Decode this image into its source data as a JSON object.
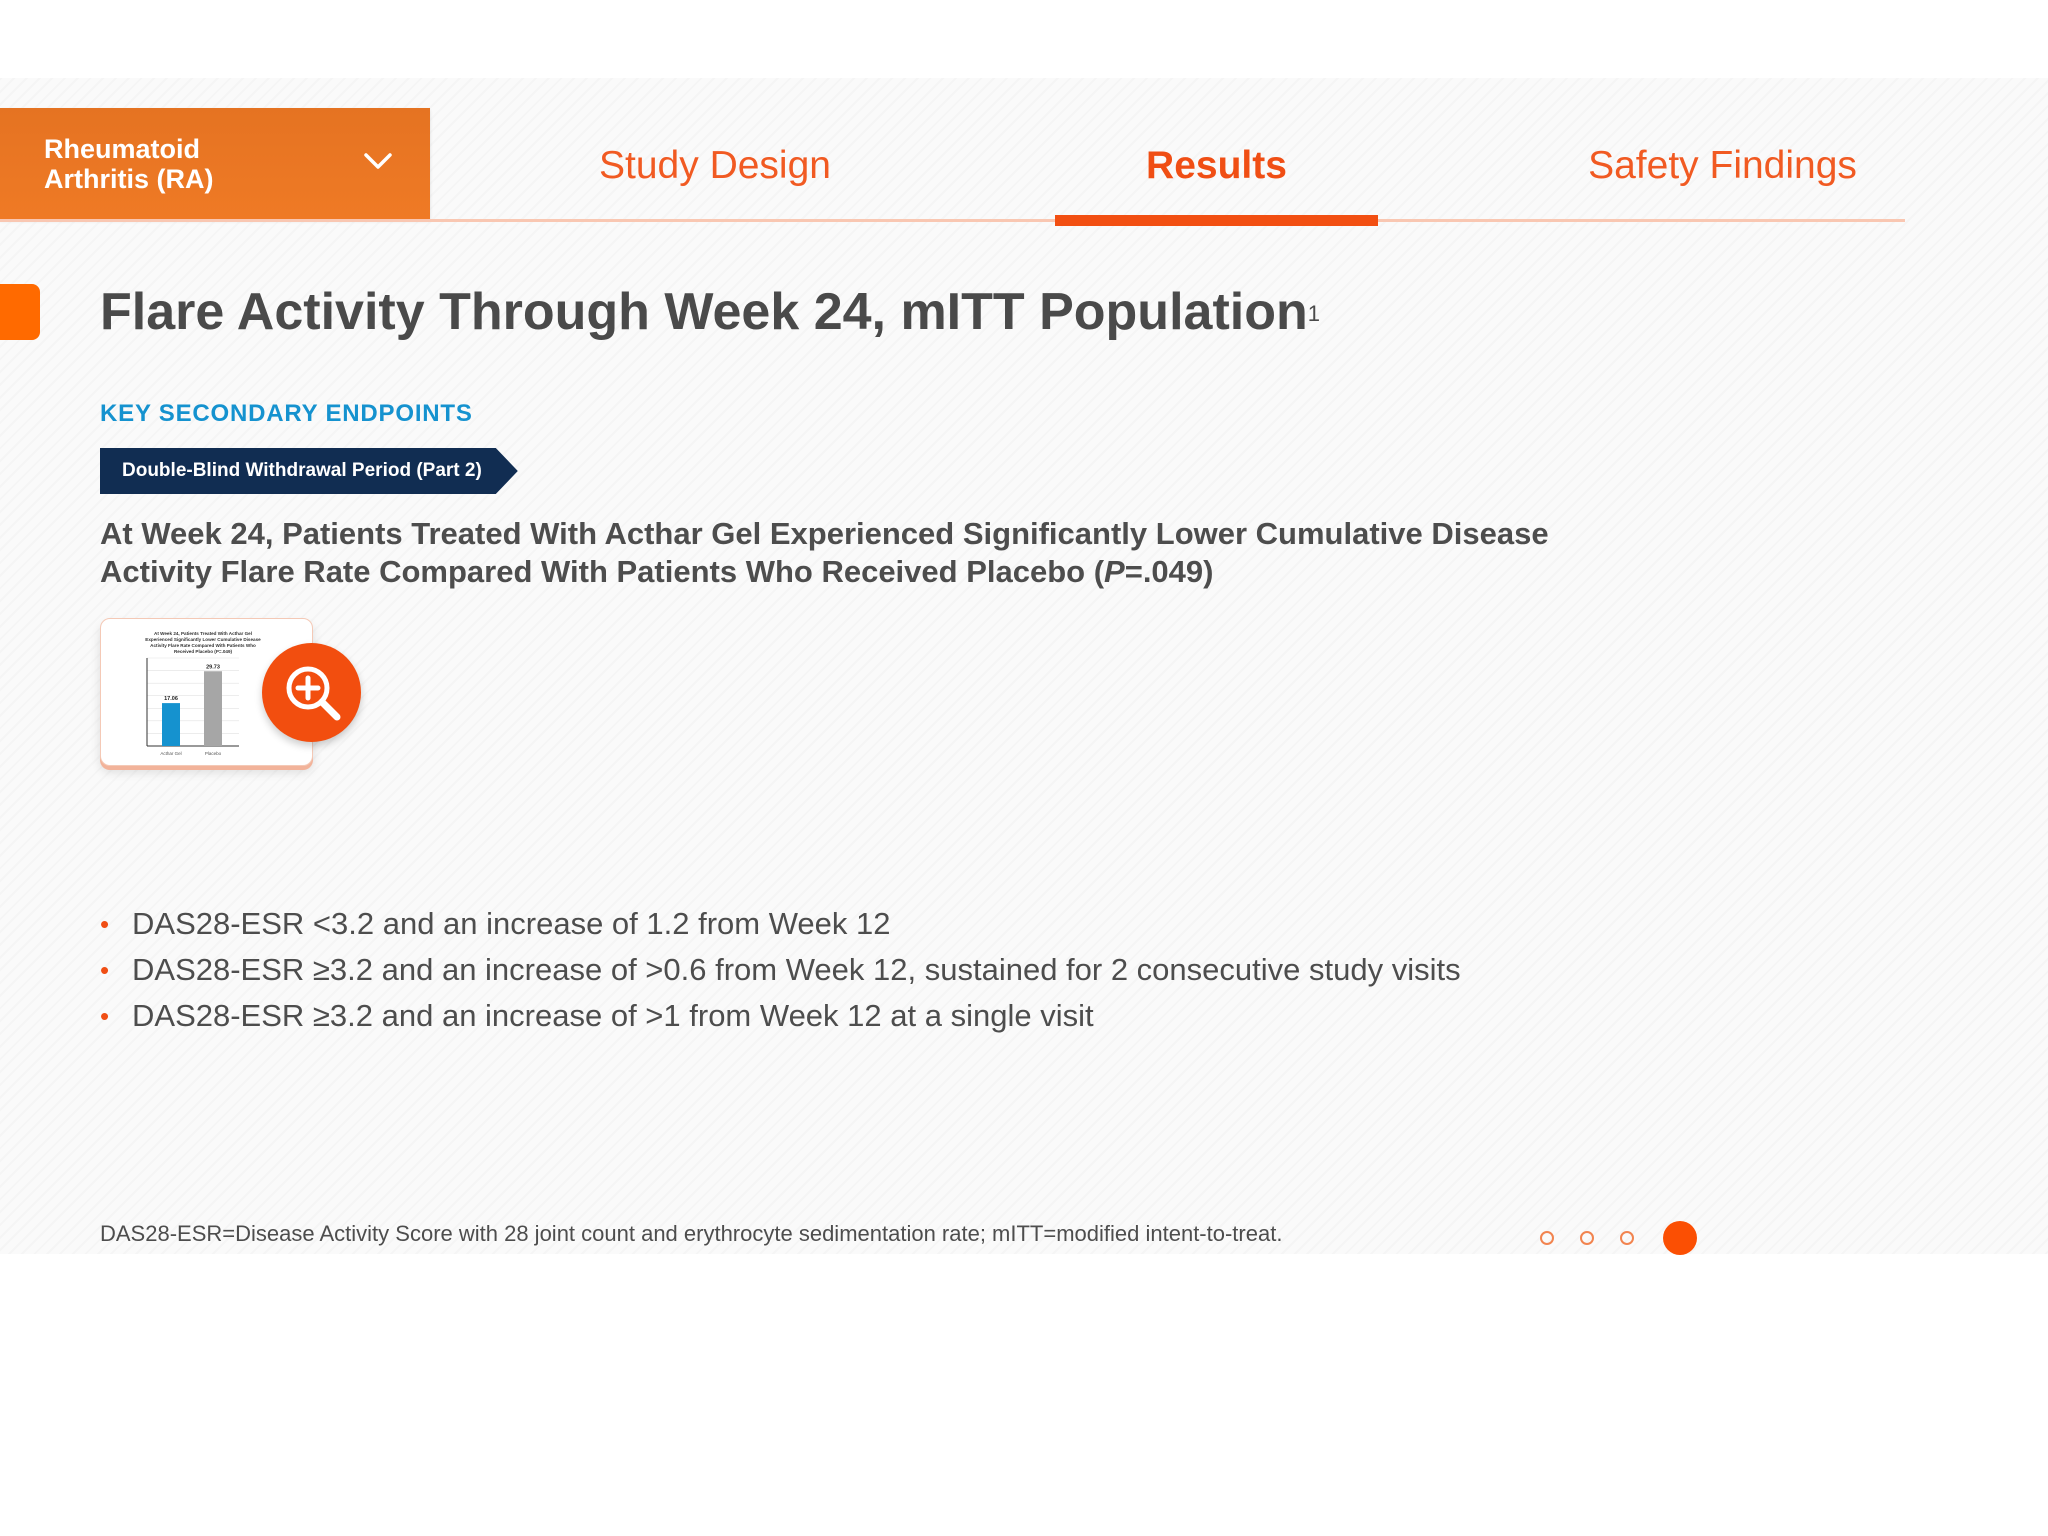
{
  "nav": {
    "dropdown_label": "Rheumatoid Arthritis (RA)",
    "tabs": [
      {
        "label": "Study Design",
        "active": false
      },
      {
        "label": "Results",
        "active": true
      },
      {
        "label": "Safety Findings",
        "active": false
      }
    ]
  },
  "content": {
    "title": "Flare Activity Through Week 24, mITT Population",
    "title_ref": "1",
    "kicker": "KEY SECONDARY ENDPOINTS",
    "ribbon": "Double-Blind Withdrawal Period (Part 2)",
    "headline_part1": "At Week 24, Patients Treated With Acthar Gel Experienced Significantly Lower Cumulative Disease Activity Flare Rate Compared With Patients Who Received Placebo (",
    "headline_p": "P",
    "headline_part2": "=.049)",
    "bullets": [
      "DAS28-ESR <3.2 and an increase of 1.2 from Week 12",
      "DAS28-ESR ≥3.2 and an increase of >0.6 from Week 12, sustained for 2 consecutive study visits",
      "DAS28-ESR ≥3.2 and an increase of >1 from Week 12 at a single visit"
    ],
    "footnote": "DAS28-ESR=Disease Activity Score with 28 joint count and erythrocyte sedimentation rate; mITT=modified intent-to-treat."
  },
  "thumbnail": {
    "title_lines": [
      "At Week 24, Patients Treated With Acthar Gel",
      "Experienced Significantly Lower Cumulative Disease",
      "Activity Flare Rate Compared With Patients Who",
      "Received Placebo (P=.049)"
    ],
    "bars": [
      {
        "label": "Acthar Gel",
        "value": 17.06,
        "color": "#1592cf"
      },
      {
        "label": "Placebo",
        "value": 29.73,
        "color": "#a6a6a6"
      }
    ],
    "ymax": 35
  },
  "pager": {
    "count": 4,
    "active_index": 3
  },
  "colors": {
    "accent": "#f24e0f",
    "navy": "#112d52",
    "blue": "#1592cf"
  },
  "icons": {
    "dropdown": "chevron-down-icon",
    "zoom": "zoom-in-icon"
  }
}
